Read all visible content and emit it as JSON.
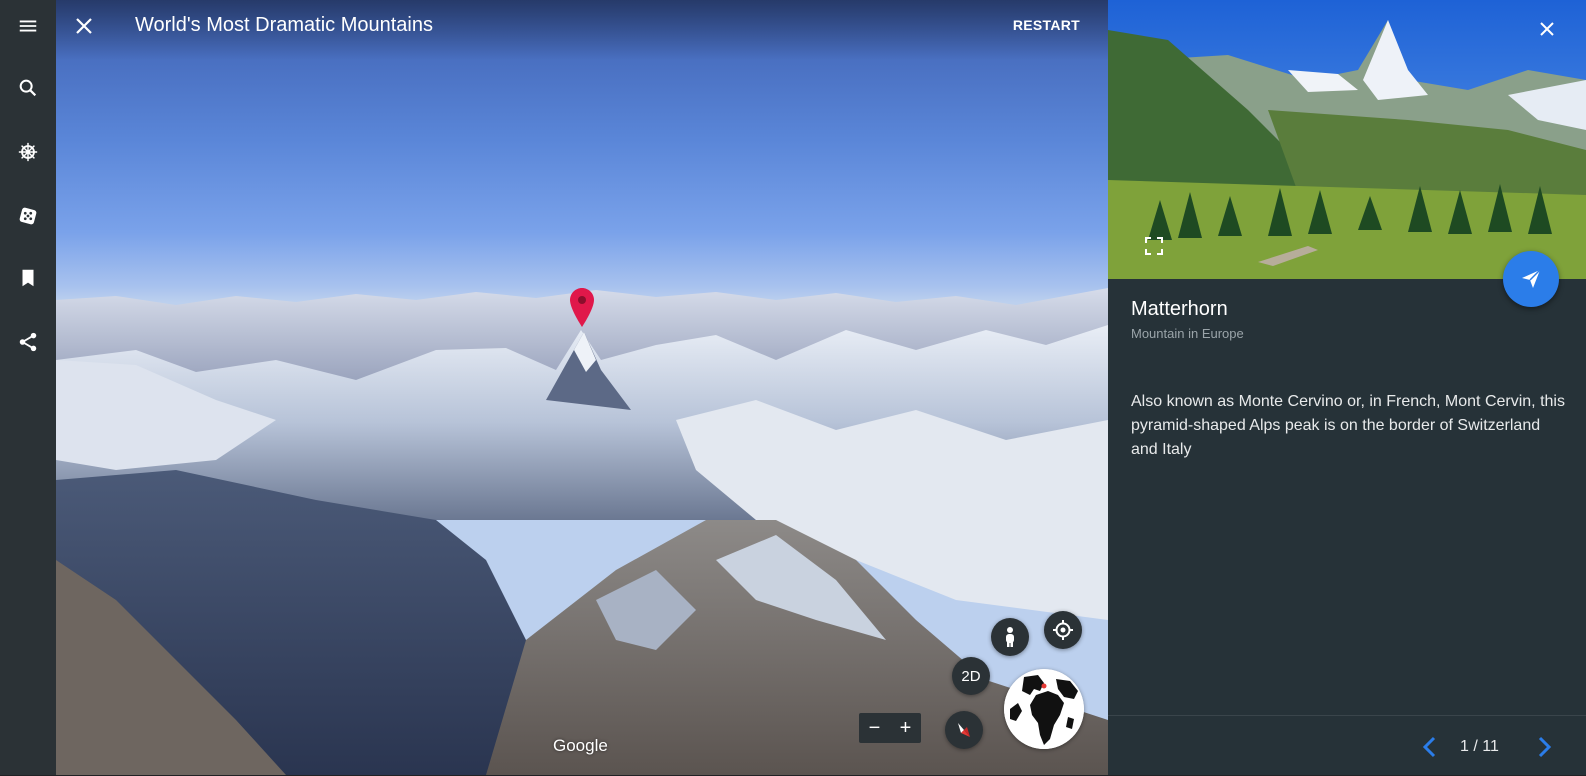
{
  "rail": {
    "items": [
      {
        "name": "menu-icon",
        "label": "Menu"
      },
      {
        "name": "search-icon",
        "label": "Search"
      },
      {
        "name": "voyager-icon",
        "label": "Voyager"
      },
      {
        "name": "dice-icon",
        "label": "I'm Feeling Lucky"
      },
      {
        "name": "bookmark-icon",
        "label": "Projects"
      },
      {
        "name": "share-icon",
        "label": "Share"
      }
    ]
  },
  "tour": {
    "title": "World's Most Dramatic Mountains",
    "restart_label": "RESTART"
  },
  "map": {
    "attribution": "Google",
    "mode_2d_label": "2D",
    "zoom_out_label": "−",
    "zoom_in_label": "+"
  },
  "panel": {
    "place_name": "Matterhorn",
    "place_type": "Mountain in Europe",
    "description": "Also known as Monte Cervino or, in French, Mont Cervin, this pyramid-shaped Alps peak is on the border of Switzerland and Italy",
    "pager": "1 / 11"
  },
  "colors": {
    "rail_bg": "#2b3236",
    "panel_bg": "#263238",
    "accent_blue": "#2b7de9",
    "pin_red": "#e0184a"
  }
}
